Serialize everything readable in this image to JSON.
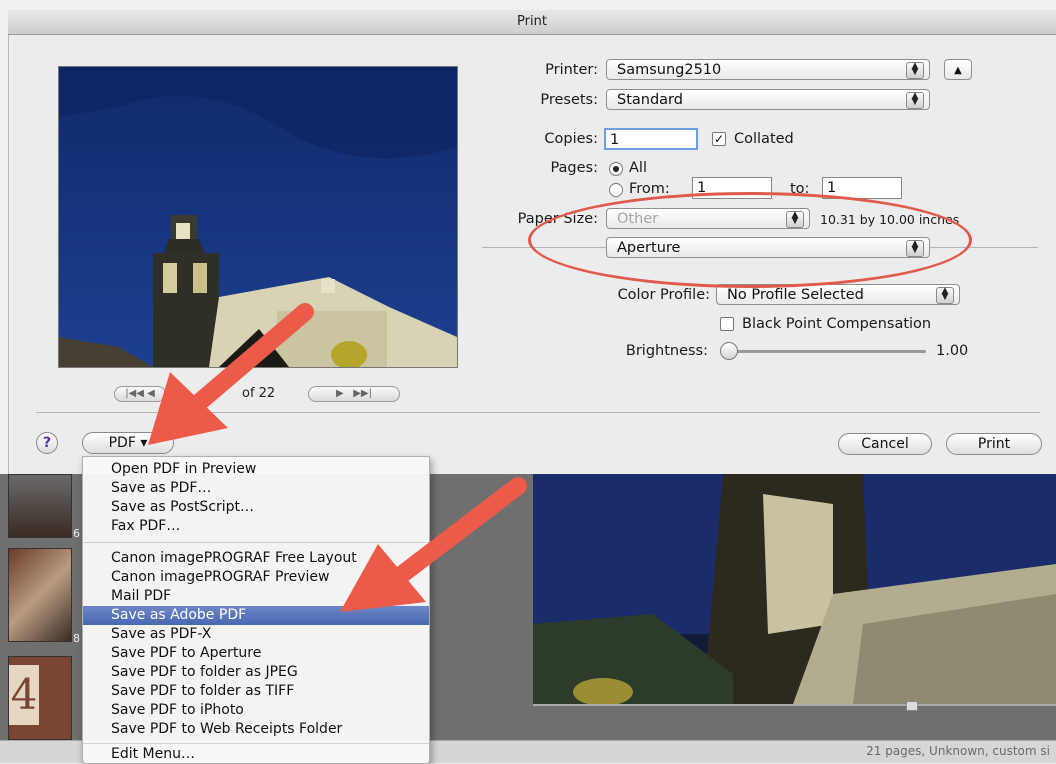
{
  "dialog": {
    "title": "Print"
  },
  "printer": {
    "label": "Printer:",
    "value": "Samsung2510"
  },
  "presets": {
    "label": "Presets:",
    "value": "Standard"
  },
  "copies": {
    "label": "Copies:",
    "value": "1",
    "collated_label": "Collated",
    "collated_checked": true
  },
  "pages": {
    "label": "Pages:",
    "all_label": "All",
    "from_label": "From:",
    "from_value": "1",
    "to_label": "to:",
    "to_value": "1"
  },
  "paper_size": {
    "label": "Paper Size:",
    "value": "Other",
    "dimensions": "10.31 by 10.00 inches"
  },
  "section_popup": {
    "value": "Aperture"
  },
  "color_profile": {
    "label": "Color Profile:",
    "value": "No Profile Selected"
  },
  "black_point": {
    "label": "Black Point Compensation",
    "checked": false
  },
  "brightness": {
    "label": "Brightness:",
    "value": "1.00",
    "level": 0.0
  },
  "preview_nav": {
    "page_text": "of 22"
  },
  "buttons": {
    "help": "?",
    "pdf": "PDF ▾",
    "cancel": "Cancel",
    "print": "Print"
  },
  "pdf_menu": {
    "group1": [
      "Open PDF in Preview",
      "Save as PDF…",
      "Save as PostScript…",
      "Fax PDF…"
    ],
    "group2": [
      "Canon imagePROGRAF Free Layout",
      "Canon imagePROGRAF Preview",
      "Mail PDF",
      "Save as Adobe PDF",
      "Save as PDF-X",
      "Save PDF to Aperture",
      "Save PDF to folder as JPEG",
      "Save PDF to folder as TIFF",
      "Save PDF to iPhoto",
      "Save PDF to Web Receipts Folder"
    ],
    "group3": [
      "Edit Menu…"
    ],
    "highlighted": "Save as Adobe PDF"
  },
  "background": {
    "thumb_numbers": [
      "6",
      "8"
    ],
    "status": "21 pages, Unknown, custom si"
  },
  "colors": {
    "annotation": "#e05a4c",
    "highlight": "#4867b3"
  }
}
